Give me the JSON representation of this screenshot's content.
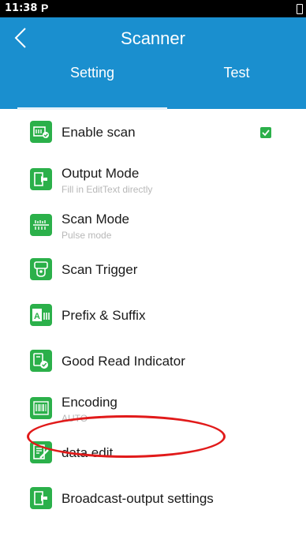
{
  "status_bar": {
    "time": "11:38",
    "app_icon": "P"
  },
  "app_bar": {
    "title": "Scanner",
    "back_icon": "chevron-left-icon"
  },
  "tabs": [
    {
      "label": "Setting",
      "selected": true
    },
    {
      "label": "Test",
      "selected": false
    }
  ],
  "settings": [
    {
      "label": "Enable scan",
      "subtitle": "",
      "icon": "enable-scan-icon",
      "checked": true
    },
    {
      "label": "Output Mode",
      "subtitle": "Fill in EditText directly",
      "icon": "output-mode-icon"
    },
    {
      "label": "Scan Mode",
      "subtitle": "Pulse mode",
      "icon": "scan-mode-icon"
    },
    {
      "label": "Scan Trigger",
      "subtitle": "",
      "icon": "scan-trigger-icon"
    },
    {
      "label": "Prefix & Suffix",
      "subtitle": "",
      "icon": "prefix-suffix-icon"
    },
    {
      "label": "Good Read Indicator",
      "subtitle": "",
      "icon": "good-read-indicator-icon",
      "highlighted": true
    },
    {
      "label": "Encoding",
      "subtitle": "AUTO",
      "icon": "encoding-icon"
    },
    {
      "label": "data edit",
      "subtitle": "",
      "icon": "data-edit-icon"
    },
    {
      "label": "Broadcast-output settings",
      "subtitle": "",
      "icon": "broadcast-output-icon"
    }
  ],
  "colors": {
    "primary": "#1a8fcf",
    "icon_green": "#2bb04a",
    "highlight_red": "#e11a1a",
    "subtitle_gray": "#b8b8b8"
  }
}
